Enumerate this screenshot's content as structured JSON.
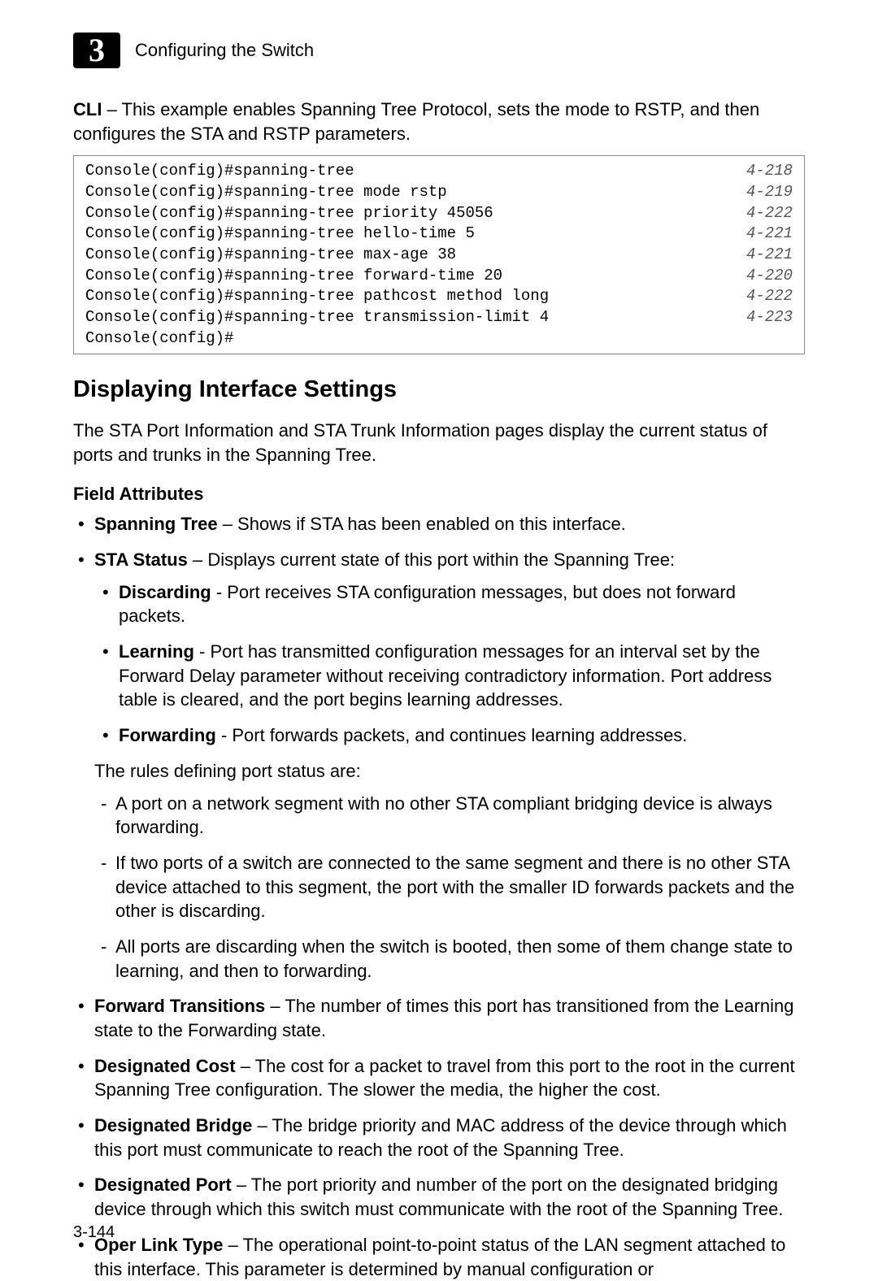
{
  "header": {
    "chapter_number": "3",
    "chapter_title": "Configuring the Switch"
  },
  "intro": {
    "cli_label": "CLI",
    "cli_text": " – This example enables Spanning Tree Protocol, sets the mode to RSTP, and then configures the STA and RSTP parameters."
  },
  "code": {
    "lines": [
      {
        "cmd": "Console(config)#spanning-tree",
        "ref": "4-218"
      },
      {
        "cmd": "Console(config)#spanning-tree mode rstp",
        "ref": "4-219"
      },
      {
        "cmd": "Console(config)#spanning-tree priority 45056",
        "ref": "4-222"
      },
      {
        "cmd": "Console(config)#spanning-tree hello-time 5",
        "ref": "4-221"
      },
      {
        "cmd": "Console(config)#spanning-tree max-age 38",
        "ref": "4-221"
      },
      {
        "cmd": "Console(config)#spanning-tree forward-time 20",
        "ref": "4-220"
      },
      {
        "cmd": "Console(config)#spanning-tree pathcost method long",
        "ref": "4-222"
      },
      {
        "cmd": "Console(config)#spanning-tree transmission-limit 4",
        "ref": "4-223"
      },
      {
        "cmd": "Console(config)#",
        "ref": ""
      }
    ]
  },
  "section": {
    "title": "Displaying Interface Settings",
    "para": "The STA Port Information and STA Trunk Information pages display the current status of ports and trunks in the Spanning Tree.",
    "field_attributes_label": "Field Attributes"
  },
  "attr": {
    "spanning_tree": {
      "label": "Spanning Tree",
      "text": " – Shows if STA has been enabled on this interface."
    },
    "sta_status": {
      "label": "STA Status",
      "text": " – Displays current state of this port within the Spanning Tree:"
    },
    "discarding": {
      "label": "Discarding",
      "text": " - Port receives STA configuration messages, but does not forward packets."
    },
    "learning": {
      "label": "Learning",
      "text": " - Port has transmitted configuration messages for an interval set by the Forward Delay parameter without receiving contradictory information. Port address table is cleared, and the port begins learning addresses."
    },
    "forwarding": {
      "label": "Forwarding",
      "text": " - Port forwards packets, and continues learning addresses."
    },
    "rules_intro": "The rules defining port status are:",
    "rule1": "A port on a network segment with no other STA compliant bridging device is always forwarding.",
    "rule2": "If two ports of a switch are connected to the same segment and there is no other STA device attached to this segment, the port with the smaller ID forwards packets and the other is discarding.",
    "rule3": "All ports are discarding when the switch is booted, then some of them change state to learning, and then to forwarding.",
    "forward_transitions": {
      "label": "Forward Transitions",
      "text": " – The number of times this port has transitioned from the Learning state to the Forwarding state."
    },
    "designated_cost": {
      "label": "Designated Cost",
      "text": " – The cost for a packet to travel from this port to the root in the current Spanning Tree configuration. The slower the media, the higher the cost."
    },
    "designated_bridge": {
      "label": "Designated Bridge",
      "text": " – The bridge priority and MAC address of the device through which this port must communicate to reach the root of the Spanning Tree."
    },
    "designated_port": {
      "label": "Designated Port",
      "text": " – The port priority and number of the port on the designated bridging device through which this switch must communicate with the root of the Spanning Tree."
    },
    "oper_link_type": {
      "label": "Oper Link Type",
      "text": " – The operational point-to-point status of the LAN segment attached to this interface. This parameter is determined by manual configuration or"
    }
  },
  "page_number": "3-144"
}
